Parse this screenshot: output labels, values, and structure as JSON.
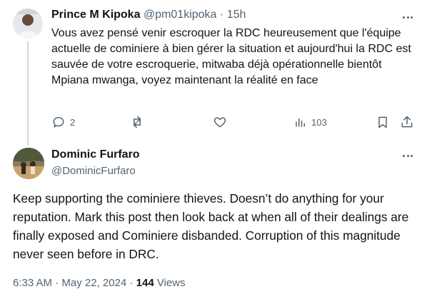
{
  "reply": {
    "display_name": "Prince M Kipoka",
    "handle": "@pm01kipoka",
    "separator": "·",
    "time": "15h",
    "text": "Vous avez pensé venir escroquer la RDC heureusement que l'équipe actuelle de cominiere à bien gérer la situation et aujourd'hui la RDC est sauvée de votre escroquerie, mitwaba déjà opérationnelle bientôt Mpiana mwanga, voyez maintenant la réalité en face",
    "actions": {
      "reply_count": "2",
      "repost_count": "",
      "like_count": "",
      "views_count": "103"
    },
    "icons": [
      "reply-icon",
      "repost-icon",
      "like-icon",
      "views-icon",
      "bookmark-icon",
      "share-icon",
      "more-icon"
    ]
  },
  "main_tweet": {
    "display_name": "Dominic Furfaro",
    "handle": "@DominicFurfaro",
    "text": "Keep supporting the cominiere thieves. Doesn’t do anything for your reputation. Mark this post then look back at when all of their dealings are finally exposed and Cominiere disbanded. Corruption of this magnitude never seen before in DRC.",
    "time": "6:33 AM",
    "separator": "·",
    "date": "May 22, 2024",
    "separator2": "·",
    "views_count": "144",
    "views_label": "Views"
  },
  "colors": {
    "text": "#0f1419",
    "muted": "#536471",
    "thread_line": "#cfd9de"
  }
}
